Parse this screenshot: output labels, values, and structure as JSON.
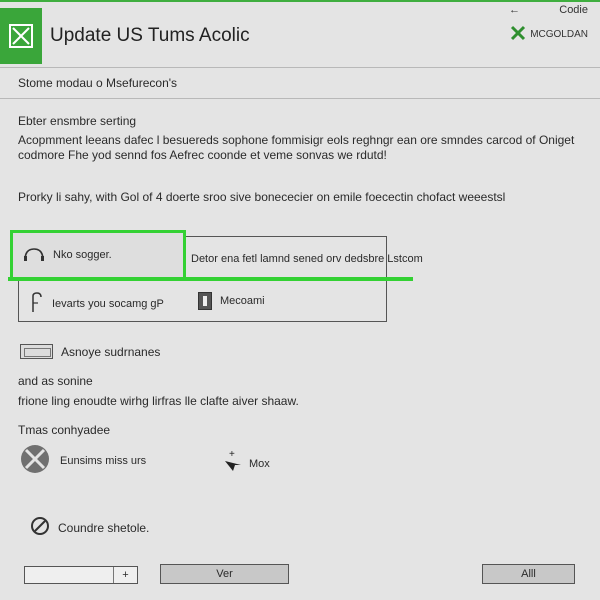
{
  "top_right": {
    "icon": "back-icon",
    "text": "Codie"
  },
  "window": {
    "title": "Update US Tums Acolic",
    "logo_icon": "x-logo-icon"
  },
  "account": {
    "icon": "green-x-icon",
    "name": "MCGOLDAN"
  },
  "subtitle": "Stome modau o Msefurecon's",
  "section": {
    "title": "Ebter ensmbre serting",
    "description": "Acopmment leeans dafec l besuereds sophone fommisigr eols reghngr ean ore smndes carcod of Oniget codmore Fhe yod sennd fos Aefrec coonde et veme sonvas we rdutd!"
  },
  "prompt": "Prorky li sahy, with Gol of 4 doerte sroo sive bonececier on emile foecectin chofact weeestsl",
  "options": {
    "selected_label": "Nko sogger.",
    "selected_description": "Detor ena fetl lamnd sened orv dedsbre Lstcom",
    "row2_left_label": "Ievarts you socamg gP",
    "row2_right_label": "Mecoami"
  },
  "ads": {
    "label": "Asnoye sudrnanes"
  },
  "and_line": "and as sonine",
  "more_line": "frione ling enoudte wirhg lirfras lle clafte aiver shaaw.",
  "tms_line": "Tmas conhyadee",
  "features": {
    "left_label": "Eunsims miss urs",
    "right_label": "Mox"
  },
  "condition": {
    "label": "Coundre shetole."
  },
  "footer": {
    "select_arrow": "+",
    "button_ver": "Ver",
    "button_all": "Alll"
  },
  "colors": {
    "accent": "#33d133",
    "logo_green": "#3aa63a"
  }
}
